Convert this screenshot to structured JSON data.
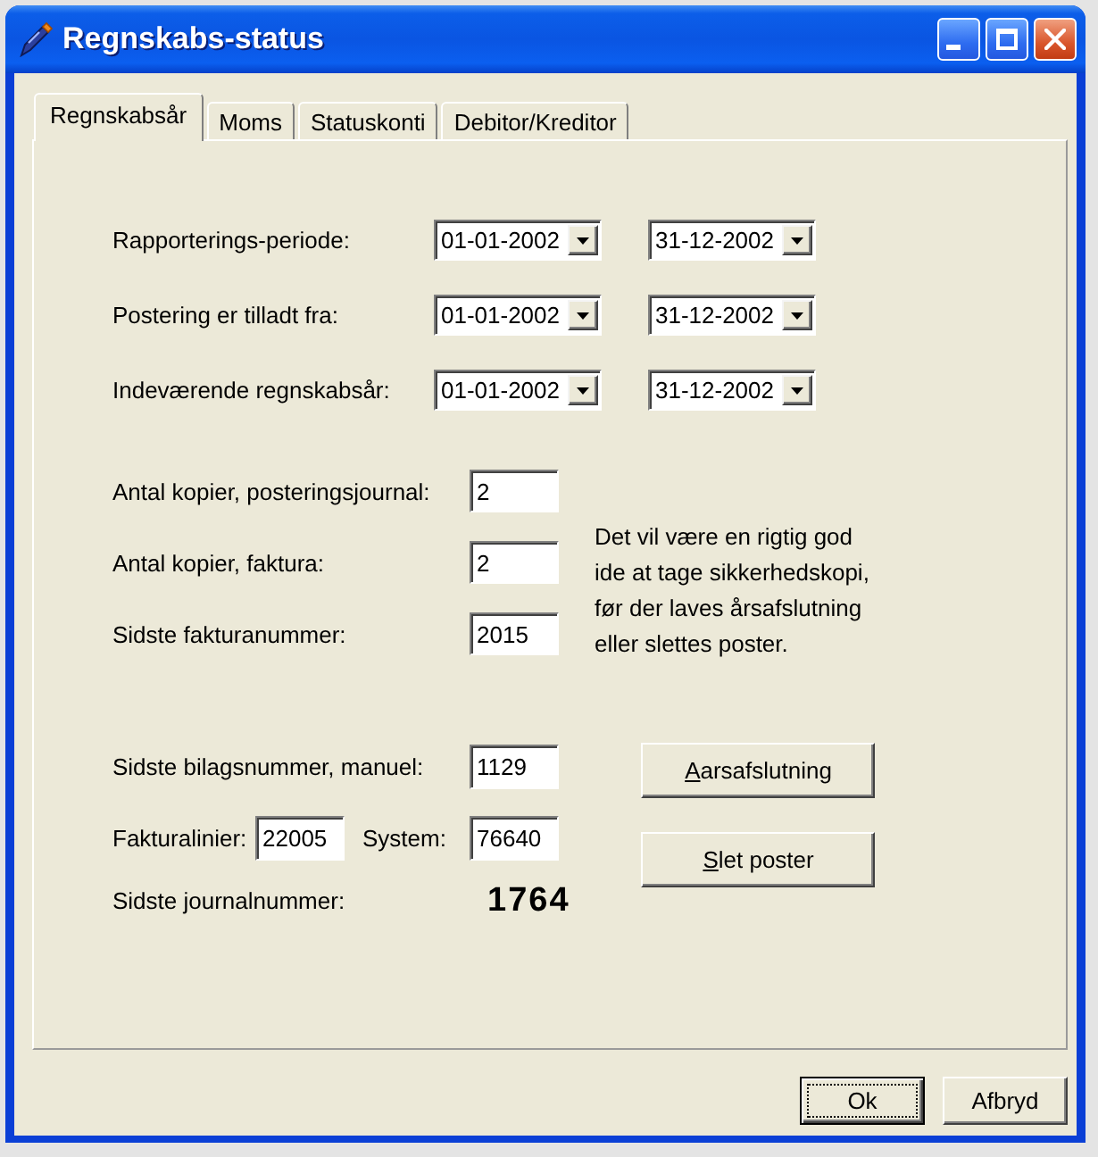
{
  "window": {
    "title": "Regnskabs-status"
  },
  "tabs": [
    {
      "label": "Regnskabsår",
      "selected": true
    },
    {
      "label": "Moms",
      "selected": false
    },
    {
      "label": "Statuskonti",
      "selected": false
    },
    {
      "label": "Debitor/Kreditor",
      "selected": false
    }
  ],
  "periods": [
    {
      "label": "Rapporterings-periode:",
      "from": "01-01-2002",
      "to": "31-12-2002"
    },
    {
      "label": "Postering er tilladt fra:",
      "from": "01-01-2002",
      "to": "31-12-2002"
    },
    {
      "label": "Indeværende regnskabsår:",
      "from": "01-01-2002",
      "to": "31-12-2002"
    }
  ],
  "copies": [
    {
      "label": "Antal kopier, posteringsjournal:",
      "value": "2"
    },
    {
      "label": "Antal kopier, faktura:",
      "value": "2"
    },
    {
      "label": "Sidste fakturanummer:",
      "value": "2015"
    }
  ],
  "note": "Det vil være en rigtig god\nide at tage sikkerhedskopi,\nfør der laves årsafslutning\neller slettes poster.",
  "voucher": {
    "label": "Sidste bilagsnummer, manuel:",
    "value": "1129"
  },
  "invoice_lines": {
    "label": "Fakturalinier:",
    "value": "22005"
  },
  "system": {
    "label": "System:",
    "value": "76640"
  },
  "journal": {
    "label": "Sidste journalnummer:",
    "value": "1764"
  },
  "actions": [
    {
      "access_key": "A",
      "label_rest": "arsafslutning"
    },
    {
      "access_key": "S",
      "label_rest": "let poster"
    }
  ],
  "buttons": [
    {
      "label": "Ok",
      "focused": true
    },
    {
      "label": "Afbryd",
      "focused": false
    }
  ]
}
